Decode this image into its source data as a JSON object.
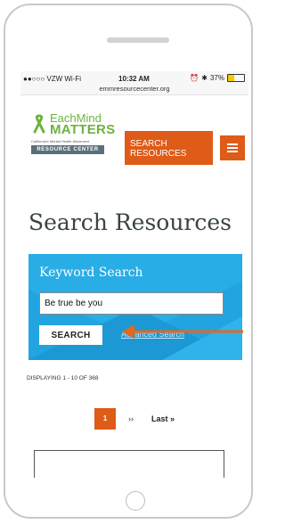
{
  "status_bar": {
    "carrier": "●●○○○ VZW Wi-Fi",
    "time": "10:32 AM",
    "battery": "37%",
    "battery_level": 0.37,
    "url": "emmresourcecenter.org",
    "icons": [
      "wifi-icon",
      "alarm-icon",
      "bluetooth-icon",
      "battery-icon"
    ]
  },
  "logo": {
    "word1": "EachMind",
    "word2": "MATTERS",
    "tagline": "California's Mental Health Movement",
    "banner": "RESOURCE CENTER"
  },
  "header": {
    "search_button": "SEARCH RESOURCES",
    "menu_icon": "hamburger-menu-icon"
  },
  "page": {
    "title": "Search Resources"
  },
  "keyword_search": {
    "title": "Keyword Search",
    "input_value": "Be true be you",
    "button": "SEARCH",
    "advanced_link": "Advanced Search"
  },
  "results": {
    "displaying": "DISPLAYING 1 - 10 OF 368"
  },
  "pagination": {
    "current": "1",
    "next": "››",
    "last": "Last »"
  },
  "colors": {
    "accent_orange": "#de5b18",
    "brand_green": "#6db33f",
    "panel_blue": "#22a4e0",
    "title_gray": "#3a4346"
  }
}
